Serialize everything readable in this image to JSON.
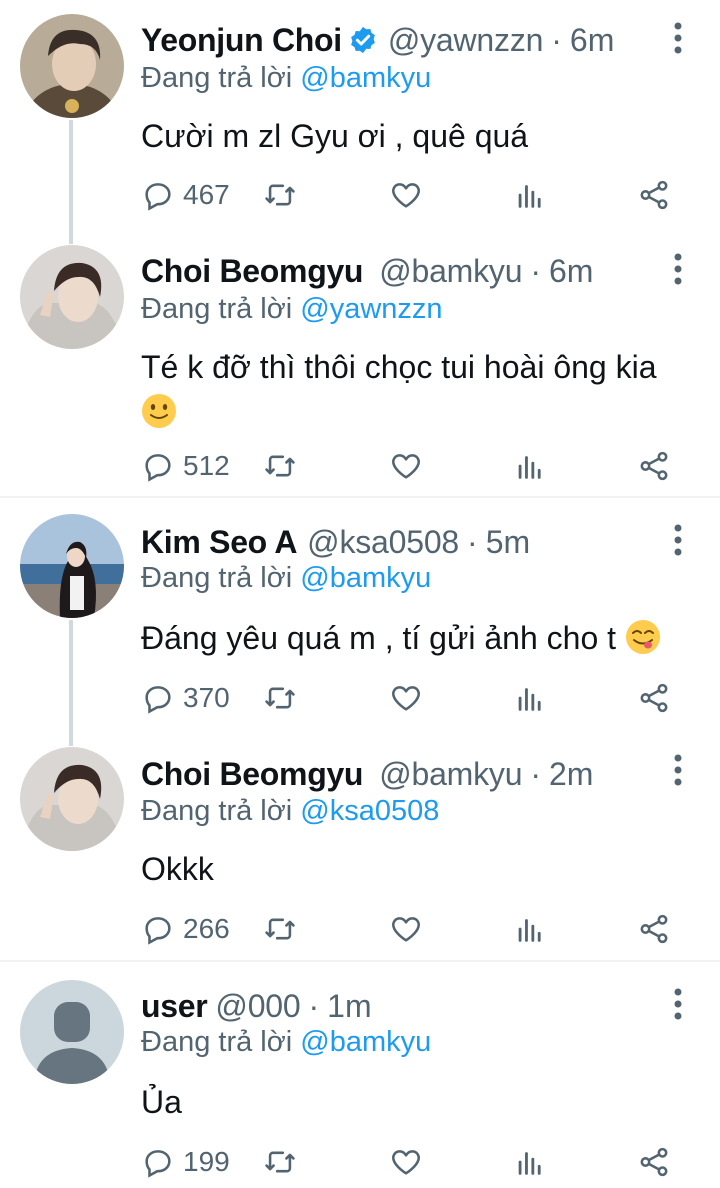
{
  "reply_prefix": "Đang trả lời",
  "colors": {
    "link": "#1d9bf0",
    "muted": "#536471",
    "thread_line": "#cfd9de"
  },
  "tweets": [
    {
      "name": "Yeonjun Choi",
      "verified": true,
      "handle": "@yawnzzn",
      "time": "6m",
      "reply_to": "@bamkyu",
      "text": "Cười m zl Gyu ơi , quê quá",
      "replies": "467",
      "avatar_icon": "profile-photo"
    },
    {
      "name": "Choi Beomgyu",
      "verified": false,
      "handle": "@bamkyu",
      "time": "6m",
      "reply_to": "@yawnzzn",
      "text": "Té k đỡ thì thôi chọc tui hoài ông kia",
      "emoji": "slightly-smiling-face",
      "replies": "512",
      "avatar_icon": "profile-photo"
    },
    {
      "name": "Kim Seo A",
      "verified": false,
      "handle": "@ksa0508",
      "time": "5m",
      "reply_to": "@bamkyu",
      "text": "Đáng yêu quá m , tí gửi ảnh cho t",
      "emoji": "face-savoring-food",
      "replies": "370",
      "avatar_icon": "profile-photo-beach"
    },
    {
      "name": "Choi Beomgyu",
      "verified": false,
      "handle": "@bamkyu",
      "time": "2m",
      "reply_to": "@ksa0508",
      "text": "Okkk",
      "replies": "266",
      "avatar_icon": "profile-photo"
    },
    {
      "name": "user",
      "verified": false,
      "handle": "@000",
      "time": "1m",
      "reply_to": "@bamkyu",
      "text": "Ủa",
      "replies": "199",
      "avatar_icon": "default-avatar"
    }
  ]
}
